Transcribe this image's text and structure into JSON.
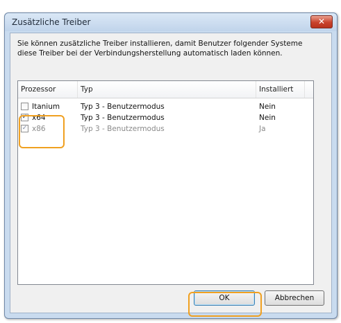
{
  "window": {
    "title": "Zusätzliche Treiber",
    "close_glyph": "✕"
  },
  "description": "Sie können zusätzliche Treiber installieren, damit Benutzer folgender Systeme diese Treiber bei der Verbindungsherstellung automatisch laden können.",
  "columns": [
    "Prozessor",
    "Typ",
    "Installiert"
  ],
  "rows": [
    {
      "processor": "Itanium",
      "type": "Typ 3 - Benutzermodus",
      "installed": "Nein",
      "checked": false,
      "dim": false
    },
    {
      "processor": "x64",
      "type": "Typ 3 - Benutzermodus",
      "installed": "Nein",
      "checked": true,
      "dim": false
    },
    {
      "processor": "x86",
      "type": "Typ 3 - Benutzermodus",
      "installed": "Ja",
      "checked": true,
      "dim": true
    }
  ],
  "buttons": {
    "ok": "OK",
    "cancel": "Abbrechen"
  },
  "check_glyph": "✓",
  "colors": {
    "highlight": "#f0a020",
    "titlebar": "#c9dbef",
    "close": "#c9422c"
  }
}
